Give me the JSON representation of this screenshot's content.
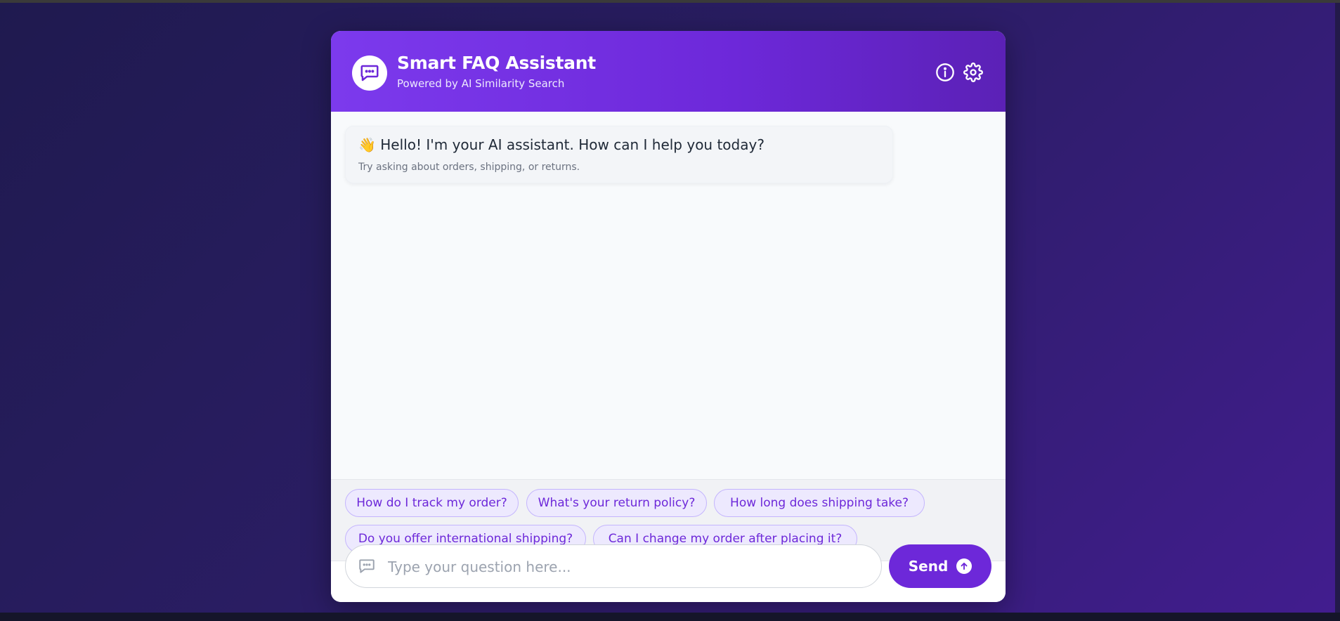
{
  "header": {
    "title": "Smart FAQ Assistant",
    "subtitle": "Powered by AI Similarity Search",
    "logo_icon": "chat-bubble-icon",
    "info_icon": "info-icon",
    "settings_icon": "gear-icon"
  },
  "welcome": {
    "emoji": "👋",
    "message": "Hello! I'm your AI assistant. How can I help you today?",
    "hint": "Try asking about orders, shipping, or returns."
  },
  "suggestions": [
    "How do I track my order?",
    "What's your return policy?",
    "How long does shipping take?",
    "Do you offer international shipping?",
    "Can I change my order after placing it?"
  ],
  "composer": {
    "placeholder": "Type your question here...",
    "value": "",
    "send_label": "Send",
    "input_icon": "chat-bubble-icon",
    "send_icon": "arrow-up-circle-icon"
  },
  "colors": {
    "accent": "#6d28d9",
    "accent_light": "#7c3aed",
    "chip_bg": "#ede9fe",
    "chip_border": "#c4b5fd",
    "page_bg_start": "#1f1a4f",
    "page_bg_end": "#421d8f"
  }
}
